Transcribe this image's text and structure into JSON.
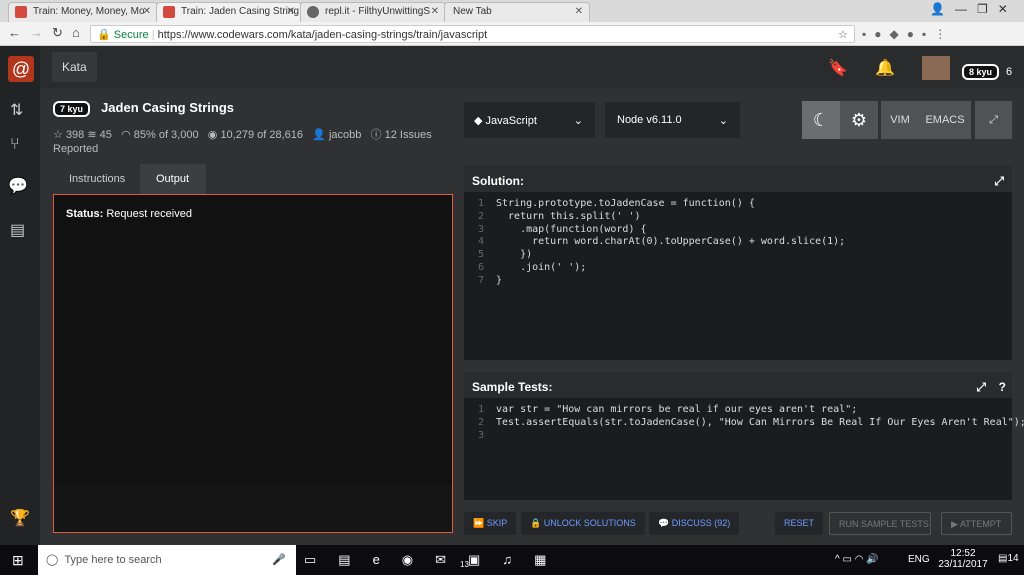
{
  "browser": {
    "tabs": [
      "Train: Money, Money, Mo",
      "Train: Jaden Casing String",
      "repl.it - FilthyUnwittingS",
      "New Tab"
    ],
    "secure": "Secure",
    "url": "https://www.codewars.com/kata/jaden-casing-strings/train/javascript"
  },
  "nav": {
    "kata": "Kata",
    "user_rank": "8 kyu",
    "honor": "6"
  },
  "kata": {
    "rank": "7 kyu",
    "title": "Jaden Casing Strings",
    "stars": "398",
    "collections": "45",
    "satisfaction": "85%",
    "satisfaction_of": "of 3,000",
    "completed": "10,279",
    "completed_of": "of 28,616",
    "author": "jacobb",
    "issues": "12 Issues",
    "reported": "Reported"
  },
  "selectors": {
    "language": "JavaScript",
    "version": "Node v6.11.0"
  },
  "editor_buttons": {
    "vim": "VIM",
    "emacs": "EMACS"
  },
  "tabs": {
    "instructions": "Instructions",
    "output": "Output"
  },
  "output": {
    "status_label": "Status:",
    "status_value": "Request received"
  },
  "solution": {
    "title": "Solution:",
    "lines": [
      "String.prototype.toJadenCase = function() {",
      "  return this.split(' ')",
      "    .map(function(word) {",
      "      return word.charAt(0).toUpperCase() + word.slice(1);",
      "    })",
      "    .join(' ');",
      "}"
    ]
  },
  "tests": {
    "title": "Sample Tests:",
    "lines": [
      "var str = \"How can mirrors be real if our eyes aren't real\";",
      "Test.assertEquals(str.toJadenCase(), \"How Can Mirrors Be Real If Our Eyes Aren't Real\");",
      ""
    ]
  },
  "actions": {
    "skip": "SKIP",
    "unlock": "UNLOCK SOLUTIONS",
    "discuss": "DISCUSS (92)",
    "reset": "RESET",
    "run": "RUN SAMPLE TESTS",
    "attempt": "ATTEMPT"
  },
  "taskbar": {
    "search": "Type here to search",
    "lang": "ENG",
    "time": "12:52",
    "date": "23/11/2017",
    "mail_badge": "13",
    "notif_badge": "14"
  }
}
